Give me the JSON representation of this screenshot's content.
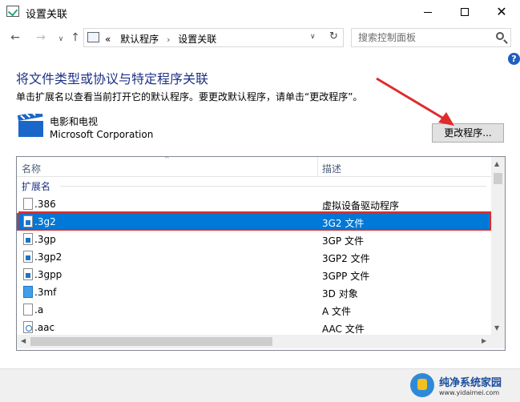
{
  "window": {
    "title": "设置关联",
    "controls": {
      "minimize": "–",
      "maximize": "",
      "close": "✕"
    }
  },
  "nav": {
    "back": "←",
    "forward": "→",
    "recent": "∨",
    "up": "↑"
  },
  "address": {
    "prefix": "«",
    "crumbs": [
      "默认程序",
      "设置关联"
    ],
    "separator": "›",
    "dropdown": "∨",
    "refresh": "↻"
  },
  "search": {
    "placeholder": "搜索控制面板"
  },
  "help": "?",
  "content": {
    "heading": "将文件类型或协议与特定程序关联",
    "instruction": "单击扩展名以查看当前打开它的默认程序。要更改默认程序，请单击“更改程序”。",
    "program_name": "电影和电视",
    "program_company": "Microsoft Corporation",
    "change_button": "更改程序..."
  },
  "list": {
    "columns": [
      "名称",
      "描述"
    ],
    "sort_indicator": "^",
    "group": "扩展名",
    "rows": [
      {
        "ext": ".386",
        "desc": "虚拟设备驱动程序",
        "icon": "blank-file-icon",
        "selected": false
      },
      {
        "ext": ".3g2",
        "desc": "3G2 文件",
        "icon": "media-file-icon",
        "selected": true
      },
      {
        "ext": ".3gp",
        "desc": "3GP 文件",
        "icon": "media-file-icon",
        "selected": false
      },
      {
        "ext": ".3gp2",
        "desc": "3GP2 文件",
        "icon": "media-file-icon",
        "selected": false
      },
      {
        "ext": ".3gpp",
        "desc": "3GPP 文件",
        "icon": "media-file-icon",
        "selected": false
      },
      {
        "ext": ".3mf",
        "desc": "3D 对象",
        "icon": "3d-object-icon",
        "selected": false
      },
      {
        "ext": ".a",
        "desc": "A 文件",
        "icon": "blank-file-icon",
        "selected": false
      },
      {
        "ext": ".aac",
        "desc": "AAC 文件",
        "icon": "audio-file-icon",
        "selected": false
      }
    ]
  },
  "scrollbar": {
    "up": "▲",
    "down": "▼",
    "left": "◀",
    "right": "▶"
  },
  "watermark": {
    "title": "纯净系统家园",
    "url": "www.yidaimei.com"
  },
  "colors": {
    "accent": "#0078d7",
    "heading": "#1e3287",
    "annotation": "#e02b2b"
  }
}
